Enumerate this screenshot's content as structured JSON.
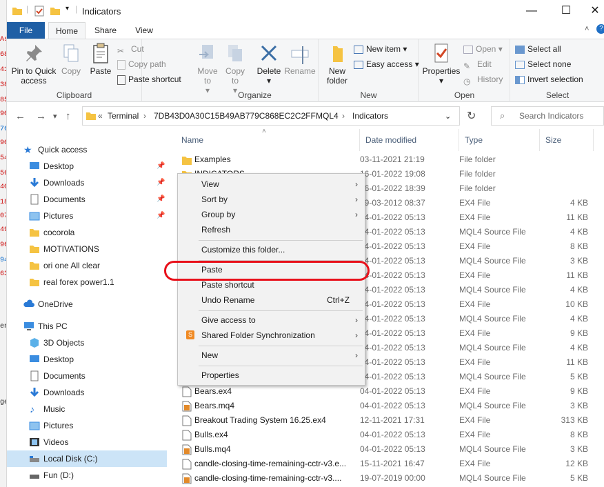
{
  "window": {
    "title": "Indicators",
    "controls": {
      "minimize": "—",
      "maximize": "☐",
      "close": "✕"
    }
  },
  "background_strip": {
    "red_numbers": [
      "As",
      "68",
      "41",
      "38",
      "85",
      "90",
      "76",
      "90",
      "54",
      "56",
      "40",
      "18",
      "07",
      "49",
      "96",
      "94",
      "63"
    ],
    "labels": [
      "en",
      "ge"
    ]
  },
  "tabs": [
    "File",
    "Home",
    "Share",
    "View"
  ],
  "ribbon": {
    "clipboard": {
      "label": "Clipboard",
      "pin": "Pin to Quick access",
      "copy": "Copy",
      "paste": "Paste",
      "cut": "Cut",
      "copy_path": "Copy path",
      "paste_shortcut": "Paste shortcut"
    },
    "organize": {
      "label": "Organize",
      "move_to": "Move to",
      "copy_to": "Copy to",
      "delete": "Delete",
      "rename": "Rename"
    },
    "new": {
      "label": "New",
      "new_folder": "New folder",
      "new_item": "New item",
      "easy_access": "Easy access"
    },
    "open": {
      "label": "Open",
      "properties": "Properties",
      "open": "Open",
      "edit": "Edit",
      "history": "History"
    },
    "select": {
      "label": "Select",
      "select_all": "Select all",
      "select_none": "Select none",
      "invert": "Invert selection"
    }
  },
  "address": {
    "prefix": "«",
    "crumbs": [
      "Terminal",
      "7DB43D0A30C15B49AB779C868EC2C2FF",
      "MQL4",
      "Indicators"
    ],
    "search_placeholder": "Search Indicators"
  },
  "sidebar": {
    "quick_access": "Quick access",
    "items": [
      "Desktop",
      "Downloads",
      "Documents",
      "Pictures",
      "cocorola",
      "MOTIVATIONS",
      "ori one All clear",
      "real forex power1.1"
    ],
    "onedrive": "OneDrive",
    "this_pc": "This PC",
    "pc_items": [
      "3D Objects",
      "Desktop",
      "Documents",
      "Downloads",
      "Music",
      "Pictures",
      "Videos",
      "Local Disk (C:)",
      "Fun (D:)"
    ]
  },
  "columns": {
    "name": "Name",
    "date": "Date modified",
    "type": "Type",
    "size": "Size"
  },
  "files": [
    {
      "name": "Examples",
      "date": "03-11-2021 21:19",
      "type": "File folder",
      "size": "",
      "icon": "folder"
    },
    {
      "name": "INDICATORS",
      "date": "16-01-2022 19:08",
      "type": "File folder",
      "size": "",
      "icon": "folder"
    },
    {
      "name": "",
      "date": "16-01-2022 18:39",
      "type": "File folder",
      "size": "",
      "icon": "folder"
    },
    {
      "name": "",
      "date": "29-03-2012 08:37",
      "type": "EX4 File",
      "size": "4 KB",
      "icon": "file"
    },
    {
      "name": "",
      "date": "04-01-2022 05:13",
      "type": "EX4 File",
      "size": "11 KB",
      "icon": "file"
    },
    {
      "name": "",
      "date": "04-01-2022 05:13",
      "type": "MQL4 Source File",
      "size": "4 KB",
      "icon": "mq"
    },
    {
      "name": "",
      "date": "04-01-2022 05:13",
      "type": "EX4 File",
      "size": "8 KB",
      "icon": "file"
    },
    {
      "name": "",
      "date": "04-01-2022 05:13",
      "type": "MQL4 Source File",
      "size": "3 KB",
      "icon": "mq"
    },
    {
      "name": "",
      "date": "04-01-2022 05:13",
      "type": "EX4 File",
      "size": "11 KB",
      "icon": "file"
    },
    {
      "name": "",
      "date": "04-01-2022 05:13",
      "type": "MQL4 Source File",
      "size": "4 KB",
      "icon": "mq"
    },
    {
      "name": "",
      "date": "04-01-2022 05:13",
      "type": "EX4 File",
      "size": "10 KB",
      "icon": "file"
    },
    {
      "name": "",
      "date": "04-01-2022 05:13",
      "type": "MQL4 Source File",
      "size": "4 KB",
      "icon": "mq"
    },
    {
      "name": "",
      "date": "04-01-2022 05:13",
      "type": "EX4 File",
      "size": "9 KB",
      "icon": "file"
    },
    {
      "name": "",
      "date": "04-01-2022 05:13",
      "type": "MQL4 Source File",
      "size": "4 KB",
      "icon": "mq"
    },
    {
      "name": "",
      "date": "04-01-2022 05:13",
      "type": "EX4 File",
      "size": "11 KB",
      "icon": "file"
    },
    {
      "name": "",
      "date": "04-01-2022 05:13",
      "type": "MQL4 Source File",
      "size": "5 KB",
      "icon": "mq"
    },
    {
      "name": "Bears.ex4",
      "date": "04-01-2022 05:13",
      "type": "EX4 File",
      "size": "9 KB",
      "icon": "file"
    },
    {
      "name": "Bears.mq4",
      "date": "04-01-2022 05:13",
      "type": "MQL4 Source File",
      "size": "3 KB",
      "icon": "mq"
    },
    {
      "name": "Breakout Trading System 16.25.ex4",
      "date": "12-11-2021 17:31",
      "type": "EX4 File",
      "size": "313 KB",
      "icon": "file"
    },
    {
      "name": "Bulls.ex4",
      "date": "04-01-2022 05:13",
      "type": "EX4 File",
      "size": "8 KB",
      "icon": "file"
    },
    {
      "name": "Bulls.mq4",
      "date": "04-01-2022 05:13",
      "type": "MQL4 Source File",
      "size": "3 KB",
      "icon": "mq"
    },
    {
      "name": "candle-closing-time-remaining-cctr-v3.e...",
      "date": "15-11-2021 16:47",
      "type": "EX4 File",
      "size": "12 KB",
      "icon": "file"
    },
    {
      "name": "candle-closing-time-remaining-cctr-v3....",
      "date": "19-07-2019 00:00",
      "type": "MQL4 Source File",
      "size": "5 KB",
      "icon": "mq"
    }
  ],
  "context_menu": {
    "view": "View",
    "sort_by": "Sort by",
    "group_by": "Group by",
    "refresh": "Refresh",
    "customize": "Customize this folder...",
    "paste": "Paste",
    "paste_shortcut": "Paste shortcut",
    "undo_rename": "Undo Rename",
    "undo_key": "Ctrl+Z",
    "give_access": "Give access to",
    "shared_sync": "Shared Folder Synchronization",
    "new": "New",
    "properties": "Properties"
  },
  "colors": {
    "file_tab": "#1f5fa5",
    "selection": "#cce4f7",
    "highlight": "#e8101a",
    "folder": "#f5c342"
  }
}
